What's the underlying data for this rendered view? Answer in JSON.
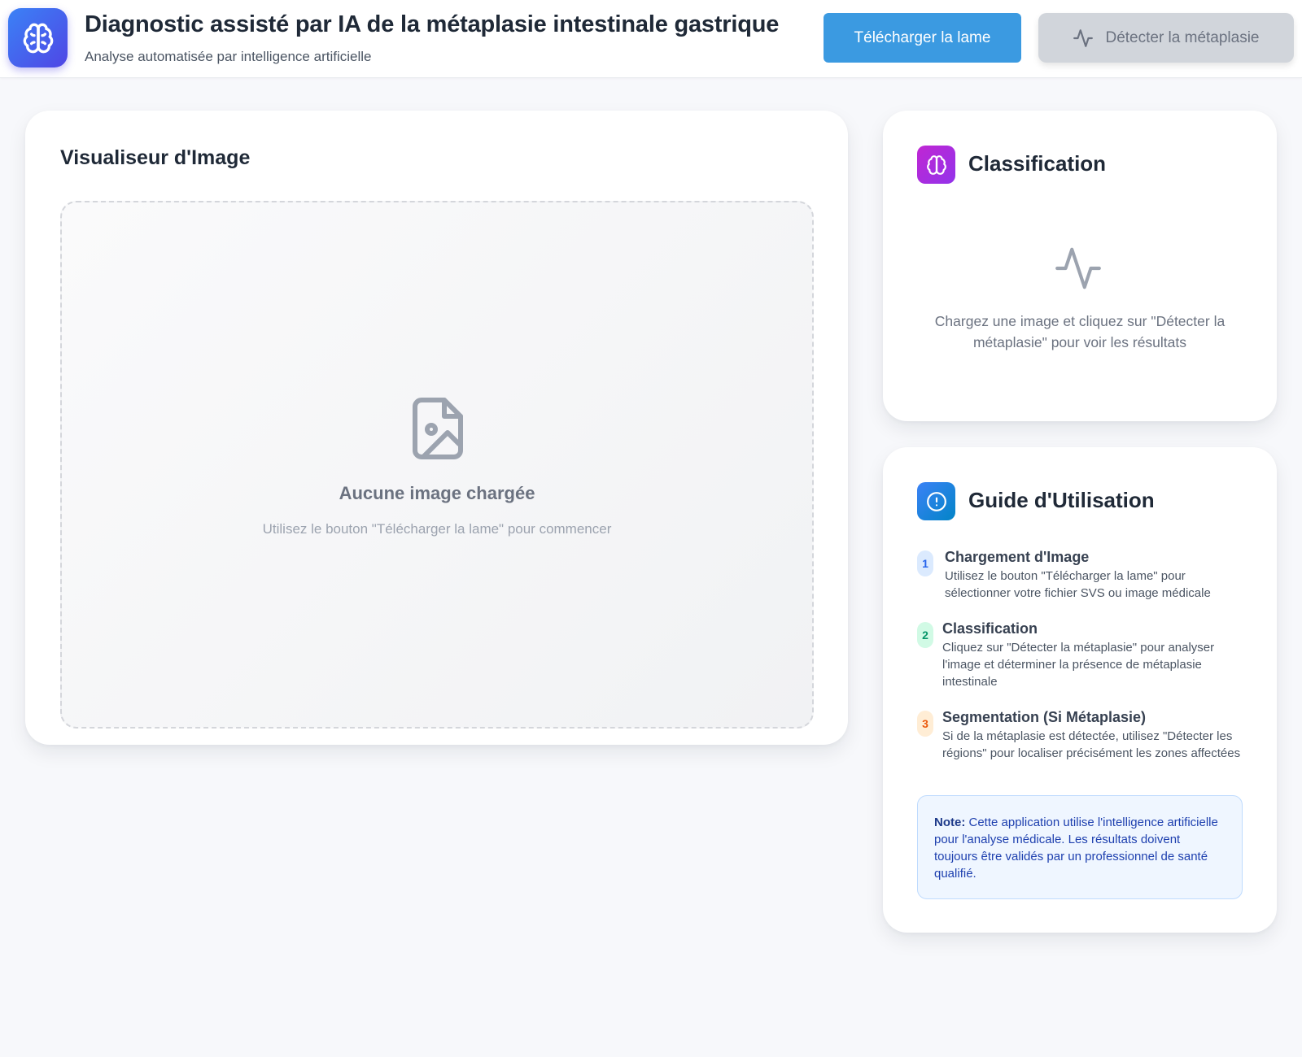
{
  "header": {
    "title": "Diagnostic assisté par IA de la métaplasie intestinale gastrique",
    "subtitle": "Analyse automatisée par intelligence artificielle",
    "upload_label": "Télécharger la lame",
    "detect_label": "Détecter la métaplasie",
    "logo_icon": "brain-icon",
    "detect_icon": "activity-icon"
  },
  "viewer": {
    "title": "Visualiseur d'Image",
    "empty_title": "Aucune image chargée",
    "empty_hint": "Utilisez le bouton \"Télécharger la lame\" pour commencer",
    "empty_icon": "image-file-icon"
  },
  "classification": {
    "title": "Classification",
    "icon": "brain-icon",
    "empty_icon": "activity-icon",
    "empty_message": "Chargez une image et cliquez sur \"Détecter la métaplasie\" pour voir les résultats"
  },
  "guide": {
    "title": "Guide d'Utilisation",
    "icon": "info-icon",
    "steps": [
      {
        "number": "1",
        "title": "Chargement d'Image",
        "description": "Utilisez le bouton \"Télécharger la lame\" pour sélectionner votre fichier SVS ou image médicale"
      },
      {
        "number": "2",
        "title": "Classification",
        "description": "Cliquez sur \"Détecter la métaplasie\" pour analyser l'image et déterminer la présence de métaplasie intestinale"
      },
      {
        "number": "3",
        "title": "Segmentation (Si Métaplasie)",
        "description": "Si de la métaplasie est détectée, utilisez \"Détecter les régions\" pour localiser précisément les zones affectées"
      }
    ],
    "note_label": "Note:",
    "note_text": "Cette application utilise l'intelligence artificielle pour l'analyse médicale. Les résultats doivent toujours être validés par un professionnel de santé qualifié."
  },
  "colors": {
    "primary_button": "#3b9ae1",
    "disabled_button": "#d1d5db",
    "logo_gradient": [
      "#3b82f6",
      "#4f46e5"
    ],
    "classification_icon": "#c026d3",
    "guide_icon": "#0284c7"
  }
}
